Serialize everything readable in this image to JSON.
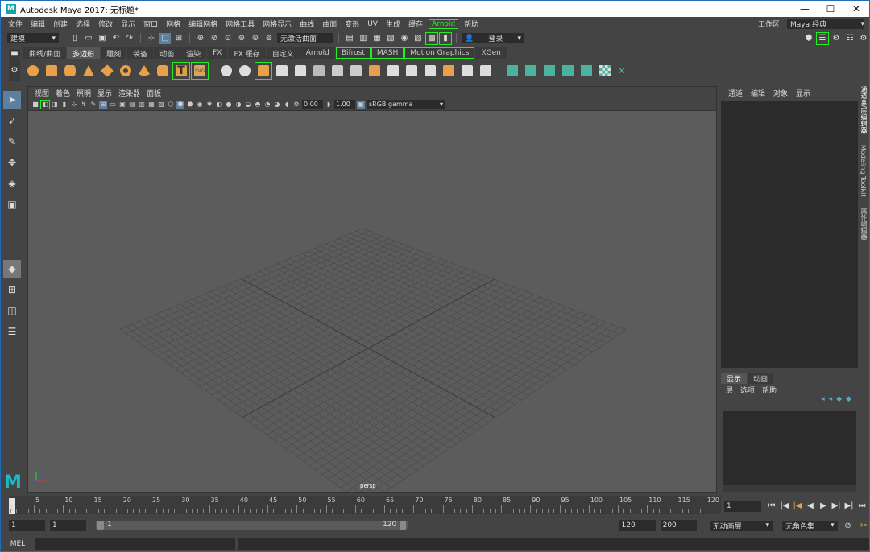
{
  "window": {
    "title": "Autodesk Maya 2017: 无标题*",
    "logo": "M",
    "controls": [
      "—",
      "☐",
      "✕"
    ]
  },
  "menu": [
    "文件",
    "编辑",
    "创建",
    "选择",
    "修改",
    "显示",
    "窗口",
    "网格",
    "编辑网格",
    "网格工具",
    "网格显示",
    "曲线",
    "曲面",
    "变形",
    "UV",
    "生成",
    "缓存",
    "Arnold",
    "帮助"
  ],
  "workspace": {
    "label": "工作区:",
    "value": "Maya 经典"
  },
  "status_line": {
    "mode": "建模",
    "live_surface": "无激活曲面",
    "login": "登录"
  },
  "shelf_tabs": [
    "曲线/曲面",
    "多边形",
    "雕刻",
    "装备",
    "动画",
    "渲染",
    "FX",
    "FX 缓存",
    "自定义",
    "Arnold",
    "Bifrost",
    "MASH",
    "Motion Graphics",
    "XGen"
  ],
  "shelf_tabs_active": "多边形",
  "shelf_icons": {
    "t_label": "T",
    "svg_label": "SVG"
  },
  "viewport": {
    "menu": [
      "视图",
      "着色",
      "照明",
      "显示",
      "渲染器",
      "面板"
    ],
    "exposure": "0.00",
    "gamma": "1.00",
    "color_space": "sRGB gamma",
    "camera_label": "persp"
  },
  "channel_box": {
    "menu": [
      "通道",
      "编辑",
      "对象",
      "显示"
    ]
  },
  "layer_editor": {
    "tabs": [
      "显示",
      "动画"
    ],
    "active_tab": "显示",
    "menu": [
      "层",
      "选项",
      "帮助"
    ]
  },
  "side_tabs": [
    "通道盒/层编辑器",
    "Modeling Toolkit",
    "属性编辑器"
  ],
  "timeline": {
    "ticks": [
      "5",
      "10",
      "15",
      "20",
      "25",
      "30",
      "35",
      "40",
      "45",
      "50",
      "55",
      "60",
      "65",
      "70",
      "75",
      "80",
      "85",
      "90",
      "95",
      "100",
      "105",
      "110",
      "115",
      "120"
    ],
    "first_tick": "1",
    "current_frame": "1"
  },
  "playback": [
    "⏮",
    "⏭",
    "⏮",
    "◀",
    "▶",
    "▶|",
    "⏭"
  ],
  "range": {
    "start": "1",
    "playback_start": "1",
    "slider_start": "1",
    "slider_end": "120",
    "playback_end": "120",
    "end": "200",
    "anim_layer": "无动画层",
    "char_set": "无角色集"
  },
  "command_line": {
    "label": "MEL"
  },
  "colors": {
    "accent": "#22ee22",
    "highlight": "#5d7fa0",
    "shelf_orange": "#e8a04a",
    "shelf_teal": "#4ab3a0"
  }
}
